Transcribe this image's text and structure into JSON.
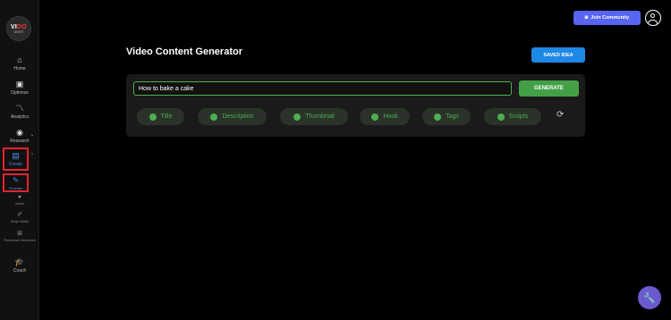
{
  "sidebar": {
    "logo": {
      "line1a": "VI",
      "line1b": "DO",
      "line2": "GENT"
    },
    "items": [
      {
        "icon": "home-icon",
        "glyph": "⌂",
        "label": "Home"
      },
      {
        "icon": "optimize-icon",
        "glyph": "▣",
        "label": "Optimize"
      },
      {
        "icon": "analytics-icon",
        "glyph": "〽",
        "label": "Analytics"
      },
      {
        "icon": "research-icon",
        "glyph": "◉",
        "label": "Research"
      },
      {
        "icon": "create-icon",
        "glyph": "▤",
        "label": "Create"
      }
    ],
    "subitems": [
      {
        "icon": "pencil-icon",
        "glyph": "✎",
        "label": "Generate"
      },
      {
        "icon": "ideas-icon",
        "glyph": "●",
        "label": "Ideas"
      },
      {
        "icon": "script-icon",
        "glyph": "✐",
        "label": "Script Writer"
      },
      {
        "icon": "thumbnail-icon",
        "glyph": "⊠",
        "label": "Thumbnail Generator"
      }
    ],
    "coach": {
      "icon": "graduation-cap-icon",
      "glyph": "🎓",
      "label": "Coach"
    }
  },
  "header": {
    "join_label": "Join Community",
    "discord_glyph": "◙"
  },
  "main": {
    "title": "Video Content Generator",
    "saved_label": "SAVED IDEA",
    "input_value": "How to bake a cake",
    "generate_label": "GENERATE",
    "chips": [
      "Title",
      "Description",
      "Thumbnail",
      "Hook",
      "Tags",
      "Scripts"
    ],
    "refresh_glyph": "⟳"
  },
  "fab": {
    "glyph": "🔧"
  },
  "colors": {
    "accent_green": "#4caf50",
    "accent_blue": "#1e88e5",
    "discord": "#5865f2",
    "highlight_red": "#e0262f"
  }
}
